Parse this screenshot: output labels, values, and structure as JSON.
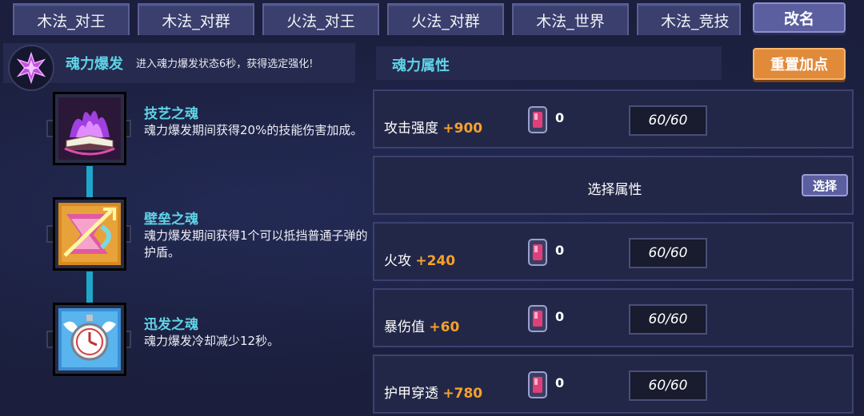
{
  "tabs": [
    "木法_对王",
    "木法_对群",
    "火法_对王",
    "火法_对群",
    "木法_世界",
    "木法_竞技"
  ],
  "rename_label": "改名",
  "burst": {
    "title": "魂力爆发",
    "description": "进入魂力爆发状态6秒，获得选定强化!"
  },
  "souls": [
    {
      "name": "技艺之魂",
      "description": "魂力爆发期间获得20%的技能伤害加成。",
      "icon": "purple-flame-book-icon"
    },
    {
      "name": "壁垒之魂",
      "description": "魂力爆发期间获得1个可以抵挡普通子弹的护盾。",
      "icon": "shield-arrow-icon"
    },
    {
      "name": "迅发之魂",
      "description": "魂力爆发冷却减少12秒。",
      "icon": "winged-clock-icon"
    }
  ],
  "attributes": {
    "title": "魂力属性",
    "reset_label": "重置加点",
    "select_text": "选择属性",
    "select_button": "选择",
    "rows": [
      {
        "name": "攻击强度",
        "bonus": "+900",
        "count": "0",
        "progress": "60/60"
      },
      {
        "name": "火攻",
        "bonus": "+240",
        "count": "0",
        "progress": "60/60"
      },
      {
        "name": "暴伤值",
        "bonus": "+60",
        "count": "0",
        "progress": "60/60"
      },
      {
        "name": "护甲穿透",
        "bonus": "+780",
        "count": "0",
        "progress": "60/60"
      }
    ]
  },
  "colors": {
    "background": "#1b1f3d",
    "accent_cyan": "#5fd3e6",
    "bonus_orange": "#f5a12c",
    "reset_orange": "#e08a3a"
  }
}
